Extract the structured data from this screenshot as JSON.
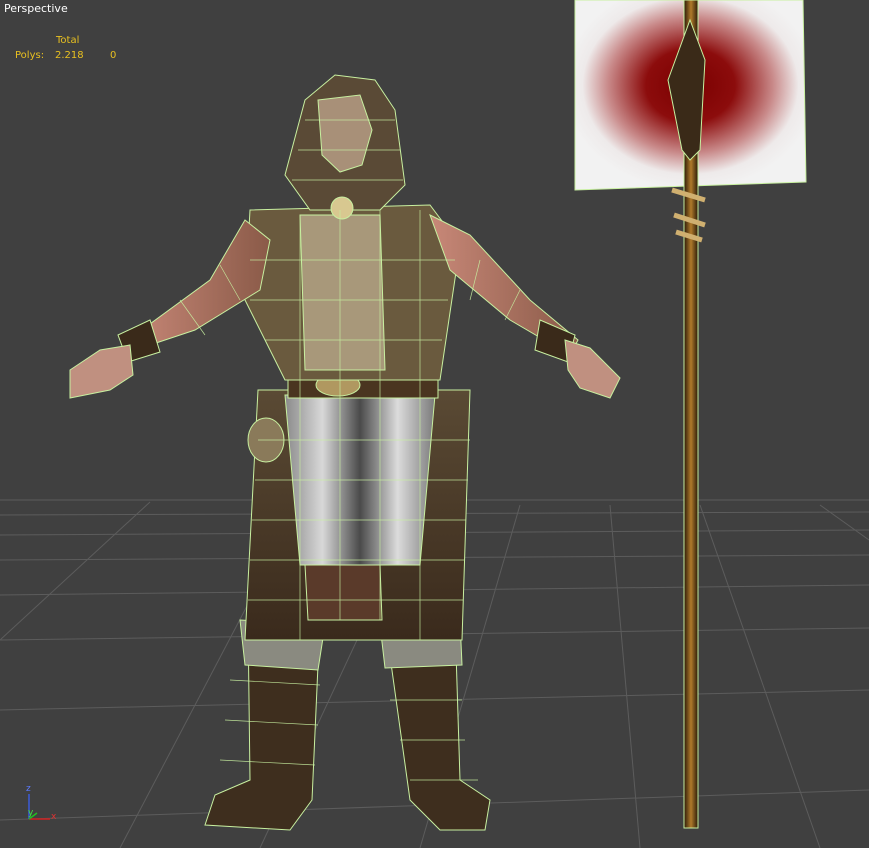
{
  "viewport": {
    "label": "Perspective"
  },
  "stats": {
    "header": "Total",
    "polys_label": "Polys:",
    "polys_value": "2.218",
    "polys_selected": "0"
  },
  "gizmo": {
    "z": "z",
    "y": "y",
    "x": "x"
  },
  "colors": {
    "viewport_bg": "#404040",
    "grid": "#5e5e5e",
    "wireframe": "#c8f0a0",
    "stats_text": "#e8c020",
    "flag_red": "#8a0a0a"
  }
}
